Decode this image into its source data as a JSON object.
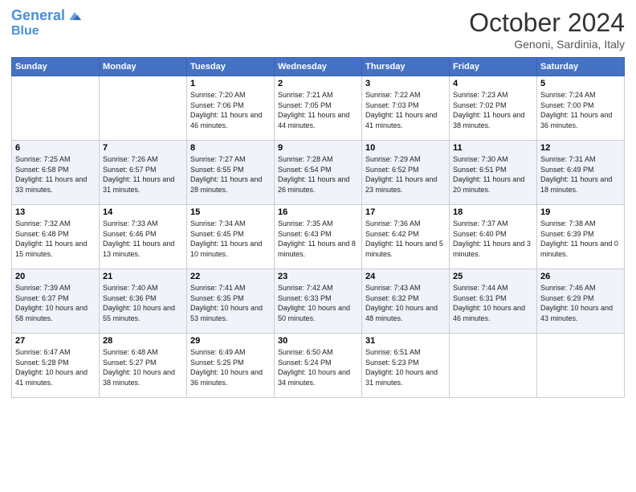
{
  "header": {
    "logo_line1": "General",
    "logo_line2": "Blue",
    "month": "October 2024",
    "location": "Genoni, Sardinia, Italy"
  },
  "days_of_week": [
    "Sunday",
    "Monday",
    "Tuesday",
    "Wednesday",
    "Thursday",
    "Friday",
    "Saturday"
  ],
  "weeks": [
    [
      {
        "day": "",
        "info": ""
      },
      {
        "day": "",
        "info": ""
      },
      {
        "day": "1",
        "info": "Sunrise: 7:20 AM\nSunset: 7:06 PM\nDaylight: 11 hours and 46 minutes."
      },
      {
        "day": "2",
        "info": "Sunrise: 7:21 AM\nSunset: 7:05 PM\nDaylight: 11 hours and 44 minutes."
      },
      {
        "day": "3",
        "info": "Sunrise: 7:22 AM\nSunset: 7:03 PM\nDaylight: 11 hours and 41 minutes."
      },
      {
        "day": "4",
        "info": "Sunrise: 7:23 AM\nSunset: 7:02 PM\nDaylight: 11 hours and 38 minutes."
      },
      {
        "day": "5",
        "info": "Sunrise: 7:24 AM\nSunset: 7:00 PM\nDaylight: 11 hours and 36 minutes."
      }
    ],
    [
      {
        "day": "6",
        "info": "Sunrise: 7:25 AM\nSunset: 6:58 PM\nDaylight: 11 hours and 33 minutes."
      },
      {
        "day": "7",
        "info": "Sunrise: 7:26 AM\nSunset: 6:57 PM\nDaylight: 11 hours and 31 minutes."
      },
      {
        "day": "8",
        "info": "Sunrise: 7:27 AM\nSunset: 6:55 PM\nDaylight: 11 hours and 28 minutes."
      },
      {
        "day": "9",
        "info": "Sunrise: 7:28 AM\nSunset: 6:54 PM\nDaylight: 11 hours and 26 minutes."
      },
      {
        "day": "10",
        "info": "Sunrise: 7:29 AM\nSunset: 6:52 PM\nDaylight: 11 hours and 23 minutes."
      },
      {
        "day": "11",
        "info": "Sunrise: 7:30 AM\nSunset: 6:51 PM\nDaylight: 11 hours and 20 minutes."
      },
      {
        "day": "12",
        "info": "Sunrise: 7:31 AM\nSunset: 6:49 PM\nDaylight: 11 hours and 18 minutes."
      }
    ],
    [
      {
        "day": "13",
        "info": "Sunrise: 7:32 AM\nSunset: 6:48 PM\nDaylight: 11 hours and 15 minutes."
      },
      {
        "day": "14",
        "info": "Sunrise: 7:33 AM\nSunset: 6:46 PM\nDaylight: 11 hours and 13 minutes."
      },
      {
        "day": "15",
        "info": "Sunrise: 7:34 AM\nSunset: 6:45 PM\nDaylight: 11 hours and 10 minutes."
      },
      {
        "day": "16",
        "info": "Sunrise: 7:35 AM\nSunset: 6:43 PM\nDaylight: 11 hours and 8 minutes."
      },
      {
        "day": "17",
        "info": "Sunrise: 7:36 AM\nSunset: 6:42 PM\nDaylight: 11 hours and 5 minutes."
      },
      {
        "day": "18",
        "info": "Sunrise: 7:37 AM\nSunset: 6:40 PM\nDaylight: 11 hours and 3 minutes."
      },
      {
        "day": "19",
        "info": "Sunrise: 7:38 AM\nSunset: 6:39 PM\nDaylight: 11 hours and 0 minutes."
      }
    ],
    [
      {
        "day": "20",
        "info": "Sunrise: 7:39 AM\nSunset: 6:37 PM\nDaylight: 10 hours and 58 minutes."
      },
      {
        "day": "21",
        "info": "Sunrise: 7:40 AM\nSunset: 6:36 PM\nDaylight: 10 hours and 55 minutes."
      },
      {
        "day": "22",
        "info": "Sunrise: 7:41 AM\nSunset: 6:35 PM\nDaylight: 10 hours and 53 minutes."
      },
      {
        "day": "23",
        "info": "Sunrise: 7:42 AM\nSunset: 6:33 PM\nDaylight: 10 hours and 50 minutes."
      },
      {
        "day": "24",
        "info": "Sunrise: 7:43 AM\nSunset: 6:32 PM\nDaylight: 10 hours and 48 minutes."
      },
      {
        "day": "25",
        "info": "Sunrise: 7:44 AM\nSunset: 6:31 PM\nDaylight: 10 hours and 46 minutes."
      },
      {
        "day": "26",
        "info": "Sunrise: 7:46 AM\nSunset: 6:29 PM\nDaylight: 10 hours and 43 minutes."
      }
    ],
    [
      {
        "day": "27",
        "info": "Sunrise: 6:47 AM\nSunset: 5:28 PM\nDaylight: 10 hours and 41 minutes."
      },
      {
        "day": "28",
        "info": "Sunrise: 6:48 AM\nSunset: 5:27 PM\nDaylight: 10 hours and 38 minutes."
      },
      {
        "day": "29",
        "info": "Sunrise: 6:49 AM\nSunset: 5:25 PM\nDaylight: 10 hours and 36 minutes."
      },
      {
        "day": "30",
        "info": "Sunrise: 6:50 AM\nSunset: 5:24 PM\nDaylight: 10 hours and 34 minutes."
      },
      {
        "day": "31",
        "info": "Sunrise: 6:51 AM\nSunset: 5:23 PM\nDaylight: 10 hours and 31 minutes."
      },
      {
        "day": "",
        "info": ""
      },
      {
        "day": "",
        "info": ""
      }
    ]
  ]
}
